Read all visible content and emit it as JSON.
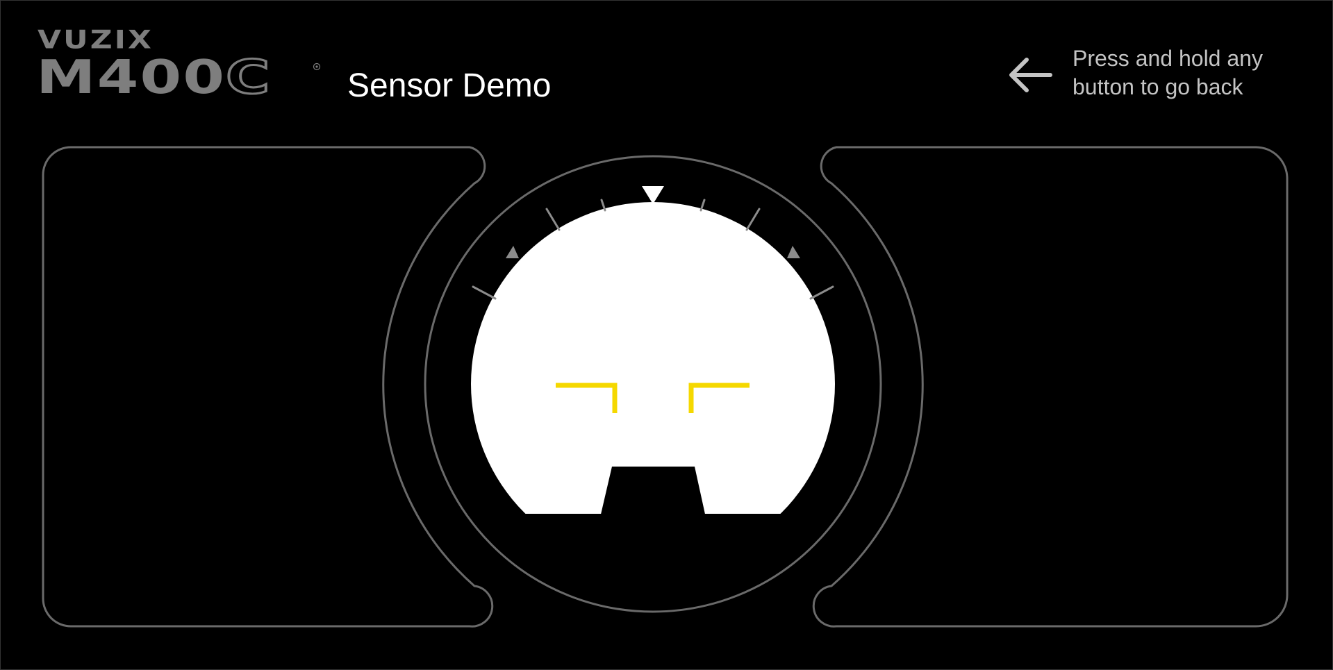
{
  "header": {
    "brand": "VUZIX",
    "model_solid": "M400",
    "model_outline": "C",
    "registered_mark": "®",
    "title": "Sensor Demo"
  },
  "back_hint": {
    "text": "Press and hold any button to go back",
    "icon": "arrow-left-icon"
  },
  "colors": {
    "background": "#000000",
    "panel_outline": "#6a6a6a",
    "logo_gray": "#7e7e7e",
    "hint_text": "#c4c4c4",
    "horizon_sky": "#ffffff",
    "reticle": "#f5d800",
    "tick": "#8c8c8c"
  },
  "icons": {
    "roll_pointer": "triangle-down-icon",
    "bank_limit_marks": "triangle-marker-icon"
  }
}
